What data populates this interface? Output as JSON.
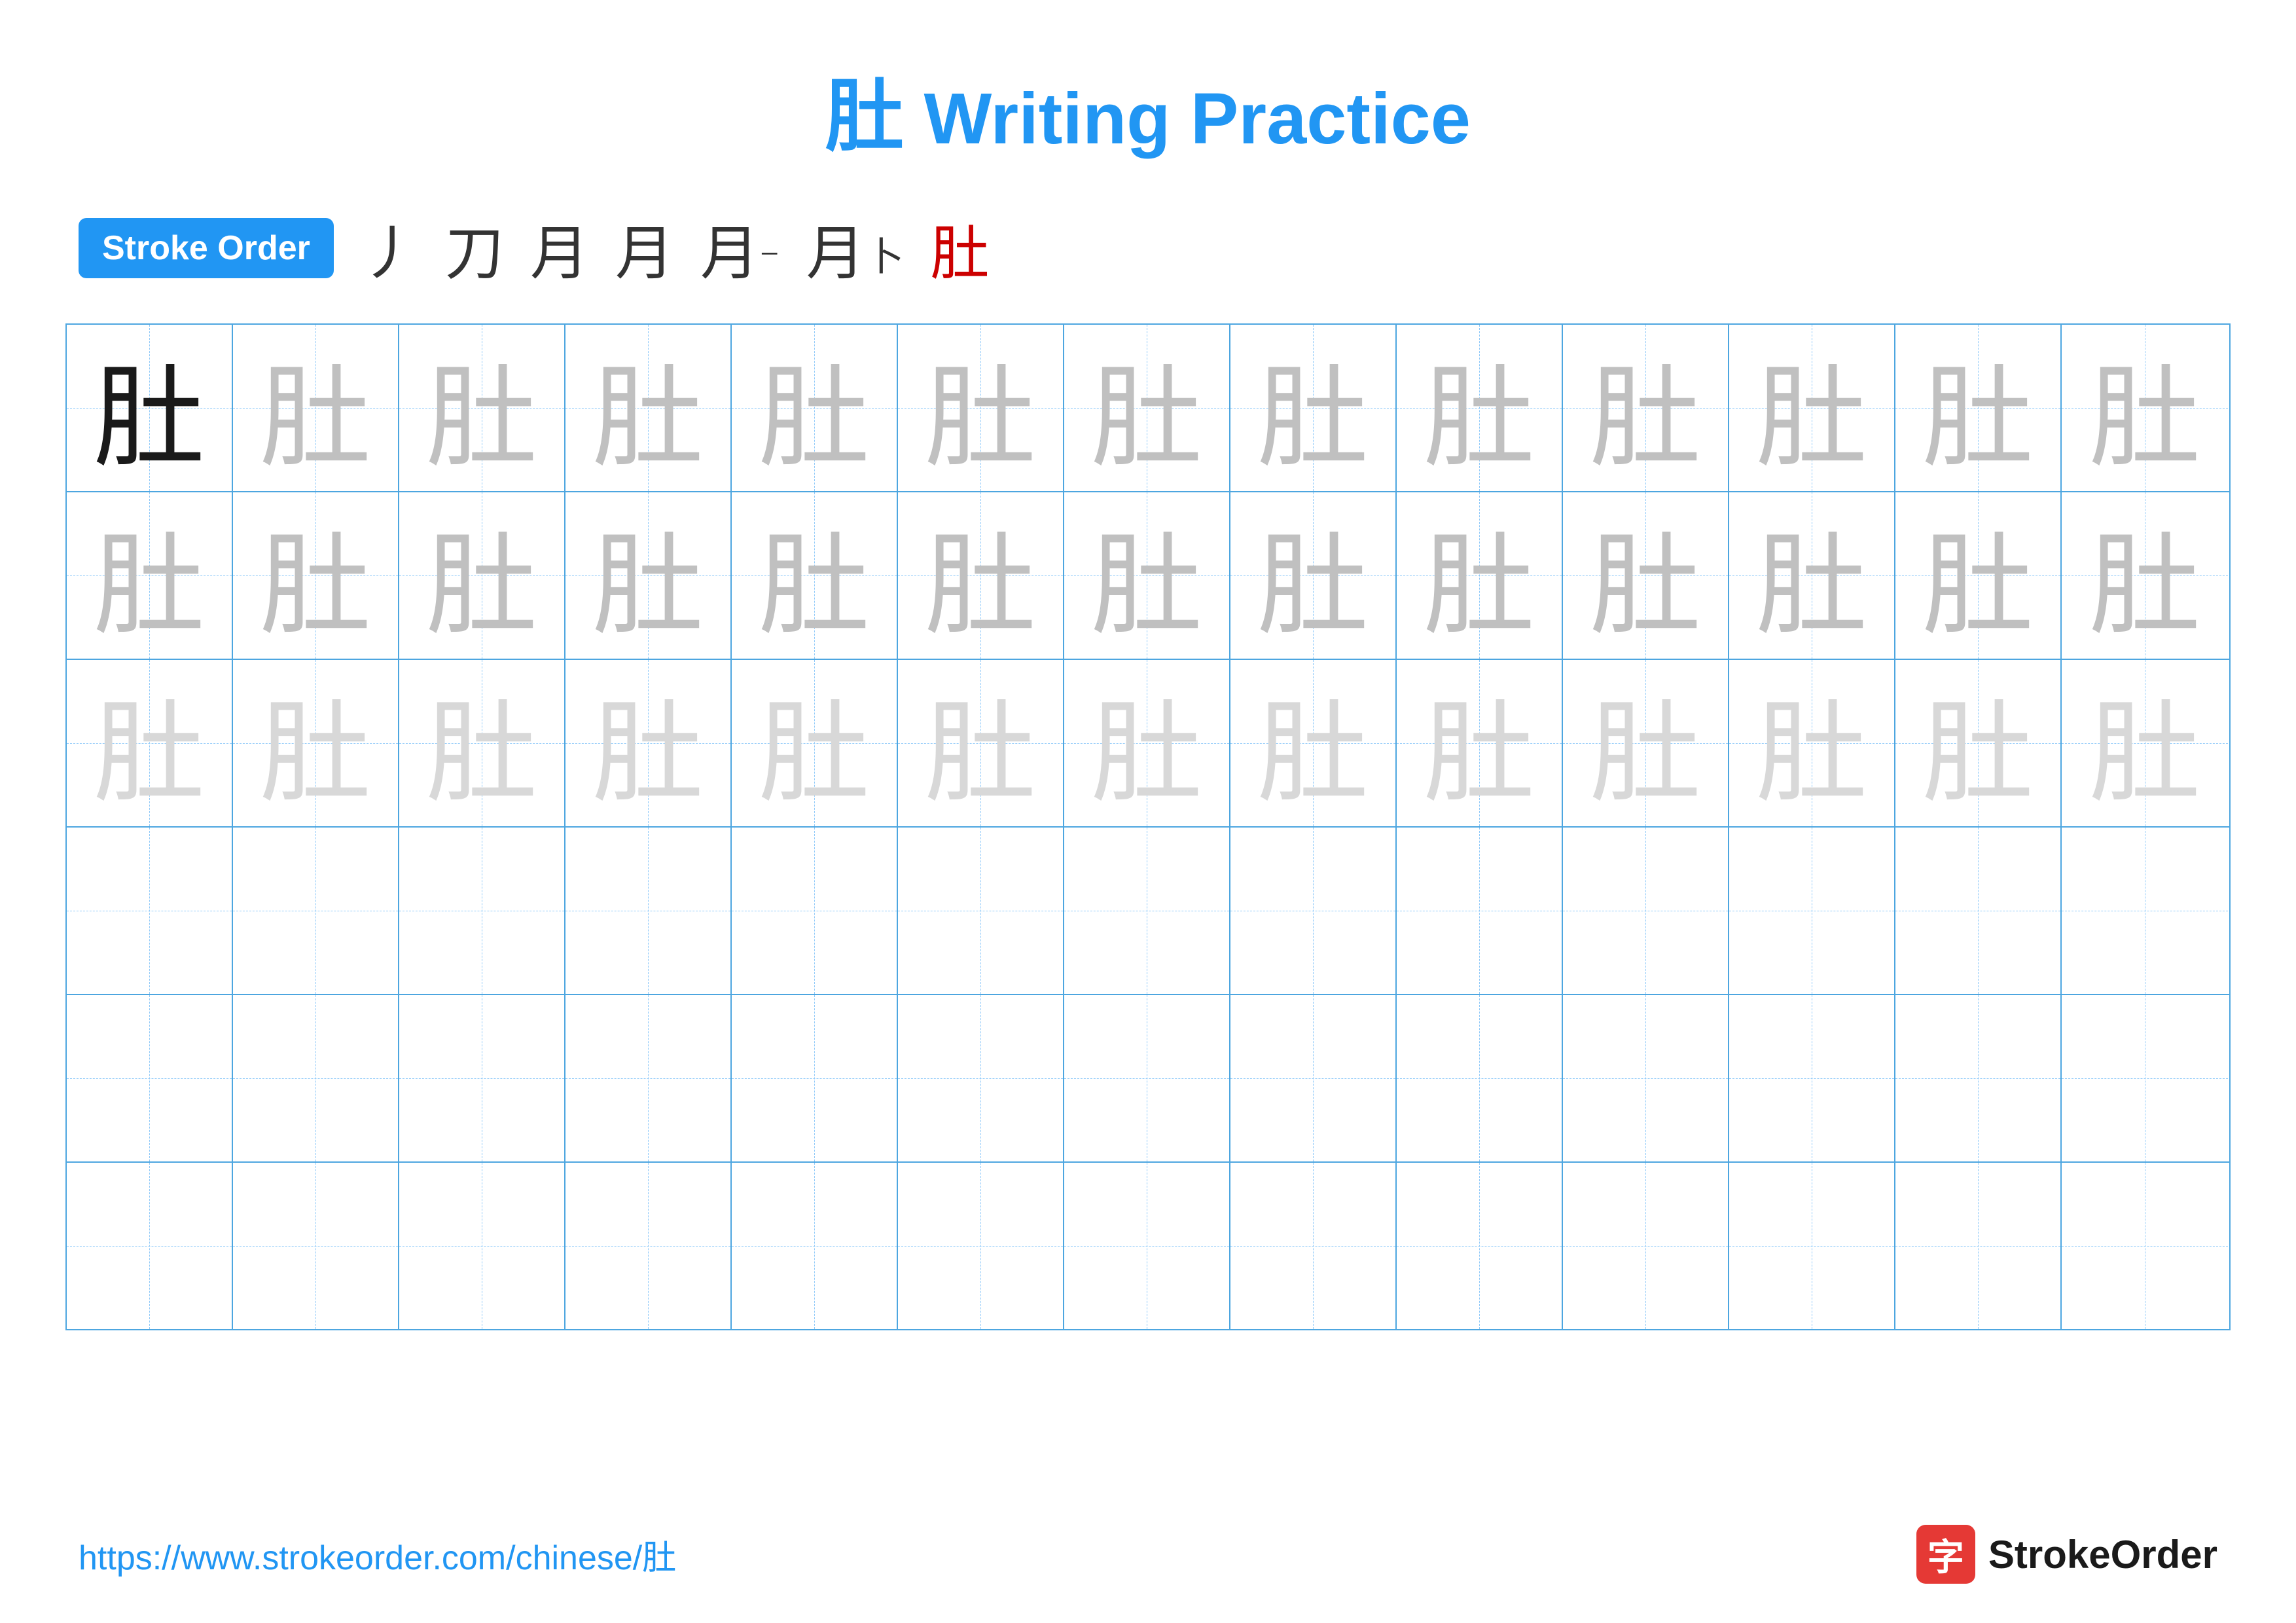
{
  "title": {
    "char": "肚",
    "text": " Writing Practice"
  },
  "stroke_order": {
    "badge_label": "Stroke Order",
    "steps": [
      "丿",
      "刀",
      "月",
      "月",
      "月⁻",
      "月卜",
      "肚"
    ]
  },
  "grid": {
    "rows": 6,
    "cols": 13,
    "character": "肚",
    "row_types": [
      "dark-then-medium",
      "medium",
      "light",
      "empty",
      "empty",
      "empty"
    ]
  },
  "footer": {
    "url": "https://www.strokeorder.com/chinese/肚",
    "logo_char": "字",
    "logo_text": "StrokeOrder"
  }
}
